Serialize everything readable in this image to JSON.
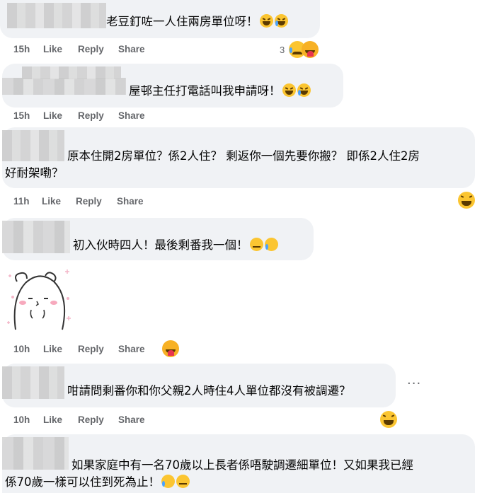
{
  "comments": [
    {
      "text": "老豆釘咗一人住兩房單位呀！",
      "time": "15h",
      "like": "Like",
      "reply": "Reply",
      "share": "Share",
      "reaction_count": "3"
    },
    {
      "text": "屋邨主任打電話叫我申請呀！",
      "time": "15h",
      "like": "Like",
      "reply": "Reply",
      "share": "Share"
    },
    {
      "line1": "原本住開2房單位？係2人住？ 剩返你一個先要你搬？ 即係2人住2房",
      "line2": "好耐架嘞？",
      "time": "11h",
      "like": "Like",
      "reply": "Reply",
      "share": "Share"
    },
    {
      "text": "初入伙時四人！最後剩番我一個！",
      "time": "10h",
      "like": "Like",
      "reply": "Reply",
      "share": "Share"
    },
    {
      "time": "10h",
      "like": "Like",
      "reply": "Reply",
      "share": "Share"
    },
    {
      "text": "咁請問剩番你和你父親2人時住4人單位都沒有被調遷？",
      "time": "10h",
      "like": "Like",
      "reply": "Reply",
      "share": "Share",
      "more": "···"
    },
    {
      "line1": "如果家庭中有一名70歲以上長者係唔駛調遷細單位！又如果我已經",
      "line2": "係70歲一樣可以住到死為止！"
    }
  ]
}
